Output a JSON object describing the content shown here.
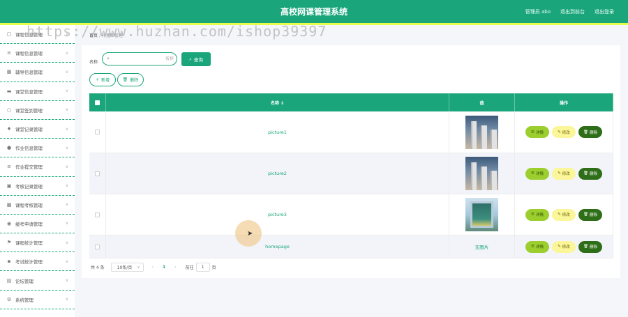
{
  "header": {
    "title": "高校网课管理系统",
    "admin_label": "管理员 abo",
    "back_label": "退出到前台",
    "logout_label": "退出登录"
  },
  "watermark": "https://www.huzhan.com/ishop39397",
  "breadcrumb": {
    "home": "首页",
    "current": "轮播图管理"
  },
  "sidebar": {
    "items": [
      {
        "label": "课程信息管理",
        "icon": "calendar-icon"
      },
      {
        "label": "课程信息管理",
        "icon": "list-icon"
      },
      {
        "label": "辅导信息管理",
        "icon": "building-icon"
      },
      {
        "label": "课堂信息管理",
        "icon": "monitor-icon"
      },
      {
        "label": "课堂签到管理",
        "icon": "circle-icon"
      },
      {
        "label": "课堂记录管理",
        "icon": "mic-icon"
      },
      {
        "label": "作业信息管理",
        "icon": "pin-icon"
      },
      {
        "label": "作业提交管理",
        "icon": "list-icon"
      },
      {
        "label": "考核记录管理",
        "icon": "box-icon"
      },
      {
        "label": "课程考核管理",
        "icon": "grid-icon"
      },
      {
        "label": "缓考申请管理",
        "icon": "help-icon"
      },
      {
        "label": "课程统计管理",
        "icon": "flag-icon"
      },
      {
        "label": "考试统计管理",
        "icon": "chat-icon"
      },
      {
        "label": "论坛管理",
        "icon": "doc-icon"
      },
      {
        "label": "系统管理",
        "icon": "gear-icon"
      }
    ]
  },
  "search": {
    "label": "名称",
    "placeholder": "名称",
    "button": "查询"
  },
  "toolbar": {
    "add": "新增",
    "delete": "删除"
  },
  "table": {
    "headers": {
      "name": "名称 ⇕",
      "value": "值",
      "ops": "操作"
    },
    "rows": [
      {
        "name": "picture1",
        "value": ""
      },
      {
        "name": "picture2",
        "value": ""
      },
      {
        "name": "picture3",
        "value": ""
      },
      {
        "name": "homepage",
        "value": "无图片"
      }
    ],
    "op_labels": {
      "detail": "详情",
      "edit": "修改",
      "remove": "删除"
    }
  },
  "pager": {
    "total": "共 4 条",
    "page_size": "10条/页",
    "current_page": "1",
    "goto_label": "前往",
    "goto_value": "1",
    "page_unit": "页"
  },
  "colors": {
    "primary": "#1aa67a",
    "accent": "#e6ff4a",
    "detail": "#9ccf2e",
    "edit": "#fbf69a",
    "remove": "#2f6e18"
  }
}
